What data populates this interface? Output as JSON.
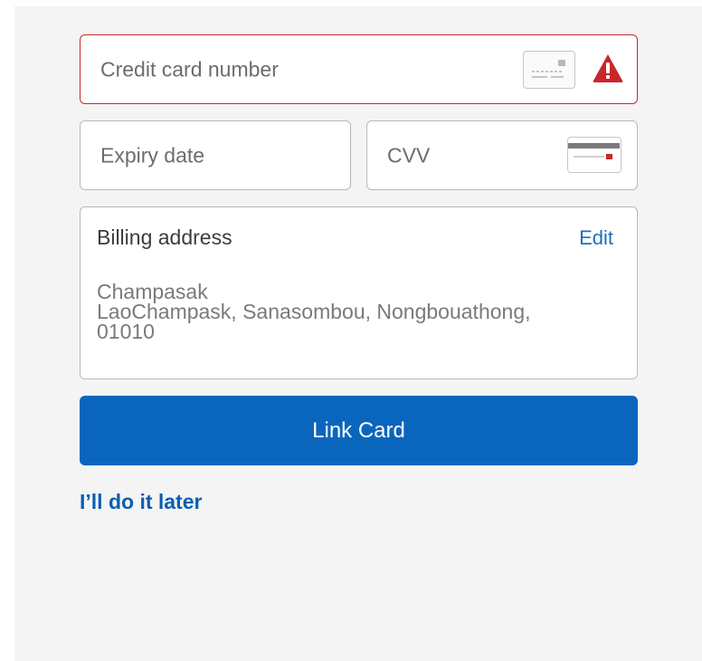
{
  "form": {
    "card_number": {
      "placeholder": "Credit card number",
      "icon": "credit-card-icon",
      "status_icon": "warning-icon",
      "status": "error"
    },
    "expiry": {
      "placeholder": "Expiry date"
    },
    "cvv": {
      "placeholder": "CVV",
      "icon": "card-back-icon"
    },
    "billing": {
      "title": "Billing address",
      "edit_label": "Edit",
      "address_lines": [
        "Champasak",
        "LaoChampask, Sanasombou, Nongbouathong,",
        "01010"
      ]
    },
    "submit_label": "Link Card",
    "later_label": "I’ll do it later"
  },
  "colors": {
    "primary": "#0a66bd",
    "error": "#c9262b",
    "link": "#1a6fc2",
    "background": "#f4f4f4"
  }
}
